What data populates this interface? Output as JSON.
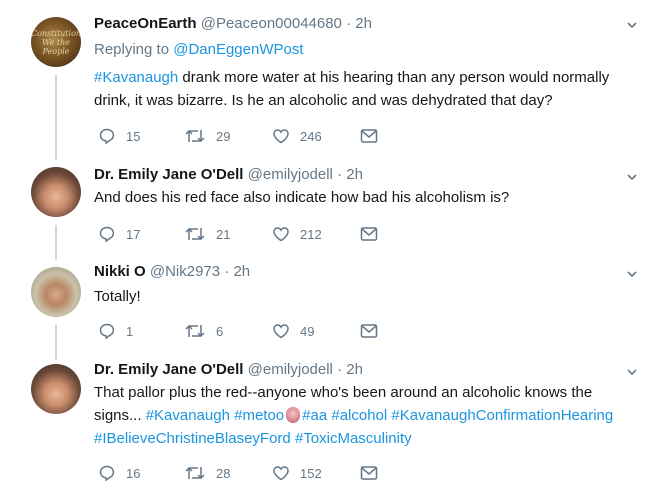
{
  "tweets": [
    {
      "name": "PeaceOnEarth",
      "handle": "@Peaceon00044680",
      "time": "2h",
      "avatar_text": "Constitution We the People",
      "replying_label": "Replying to",
      "replying_handle": "@DanEggenWPost",
      "body": [
        {
          "t": "#Kavanaugh",
          "tag": true
        },
        {
          "t": " drank more water at his hearing than any person would normally drink,  it was bizarre.  Is he an alcoholic and was dehydrated that day?",
          "tag": false
        }
      ],
      "replies": "15",
      "retweets": "29",
      "likes": "246"
    },
    {
      "name": "Dr. Emily Jane O'Dell",
      "handle": "@emilyjodell",
      "time": "2h",
      "body": [
        {
          "t": "And does his red face also indicate how bad his alcoholism is?",
          "tag": false
        }
      ],
      "replies": "17",
      "retweets": "21",
      "likes": "212"
    },
    {
      "name": "Nikki O",
      "handle": "@Nik2973",
      "time": "2h",
      "body": [
        {
          "t": "Totally!",
          "tag": false
        }
      ],
      "replies": "1",
      "retweets": "6",
      "likes": "49"
    },
    {
      "name": "Dr. Emily Jane O'Dell",
      "handle": "@emilyjodell",
      "time": "2h",
      "body": [
        {
          "t": "That pallor plus the red--anyone who's been around an alcoholic knows the signs... ",
          "tag": false
        },
        {
          "t": "#Kavanaugh",
          "tag": true
        },
        {
          "t": " ",
          "tag": false
        },
        {
          "t": "#metoo",
          "tag": true
        },
        {
          "t": "",
          "tag": false,
          "emoji": "pink-hand-emoji"
        },
        {
          "t": "#aa",
          "tag": true
        },
        {
          "t": " ",
          "tag": false
        },
        {
          "t": "#alcohol",
          "tag": true
        },
        {
          "t": " ",
          "tag": false
        },
        {
          "t": "#KavanaughConfirmationHearing",
          "tag": true
        },
        {
          "t": " ",
          "tag": false
        },
        {
          "t": "#IBelieveChristineBlaseyFord",
          "tag": true
        },
        {
          "t": " ",
          "tag": false
        },
        {
          "t": "#ToxicMasculinity",
          "tag": true
        }
      ],
      "replies": "16",
      "retweets": "28",
      "likes": "152"
    }
  ],
  "colors": {
    "link": "#1b95e0",
    "muted": "#657786",
    "text": "#14171a",
    "thread_line": "#ccd6dd"
  },
  "icons": [
    "reply-icon",
    "retweet-icon",
    "like-icon",
    "message-icon",
    "chevron-down-icon"
  ]
}
